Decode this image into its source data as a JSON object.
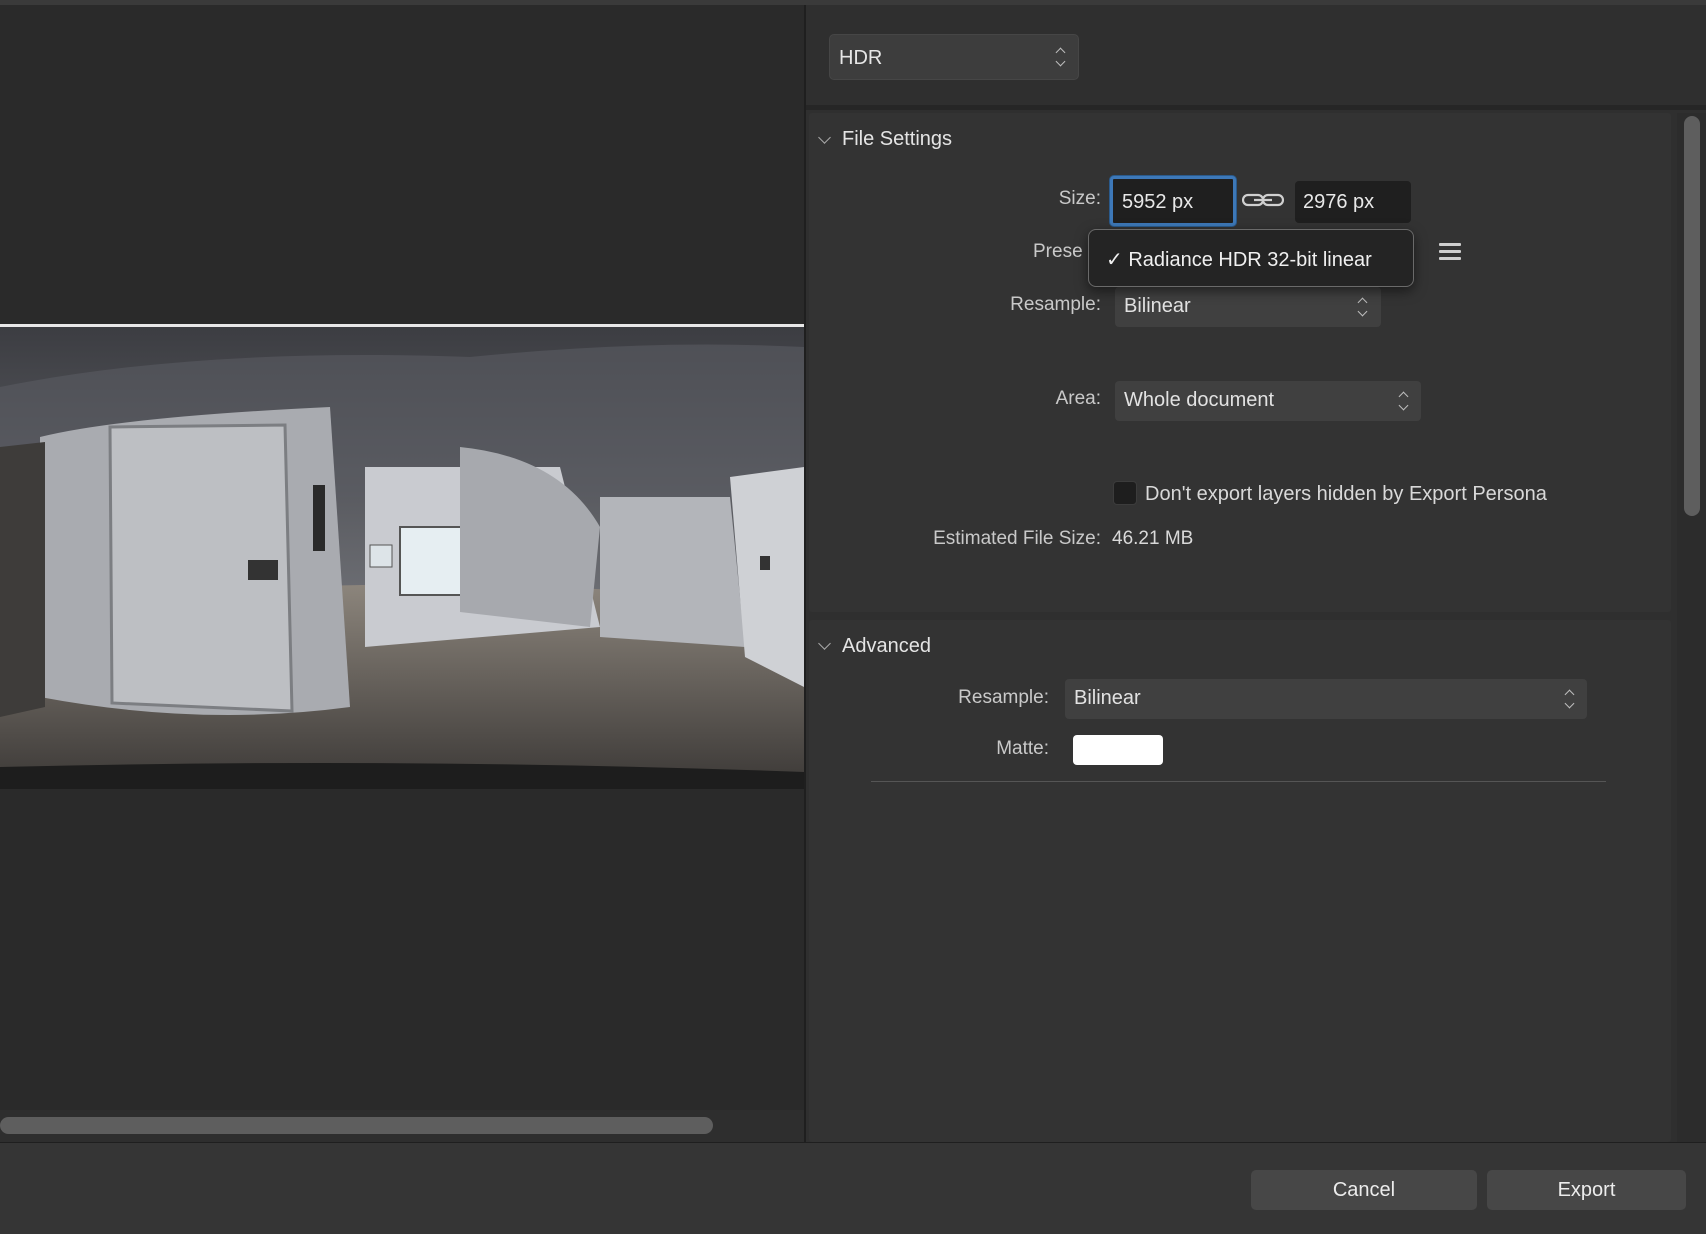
{
  "format": {
    "selected": "HDR"
  },
  "file_settings": {
    "title": "File Settings",
    "size_label": "Size:",
    "width_value": "5952 px",
    "height_value": "2976 px",
    "preset_label": "Prese",
    "preset_popup_item": "✓ Radiance HDR 32-bit linear",
    "resample_label": "Resample:",
    "resample_value": "Bilinear",
    "area_label": "Area:",
    "area_value": "Whole document",
    "hidden_layers_checkbox_label": "Don't export layers hidden by Export Persona",
    "hidden_layers_checked": false,
    "estimated_size_label": "Estimated File Size:",
    "estimated_size_value": "46.21 MB"
  },
  "advanced": {
    "title": "Advanced",
    "resample_label": "Resample:",
    "resample_value": "Bilinear",
    "matte_label": "Matte:",
    "matte_color": "#ffffff"
  },
  "footer": {
    "cancel_label": "Cancel",
    "export_label": "Export"
  },
  "colors": {
    "focus_ring": "#3d78b8",
    "panel_bg": "#333333",
    "preview_bg": "#2a2a2a"
  }
}
